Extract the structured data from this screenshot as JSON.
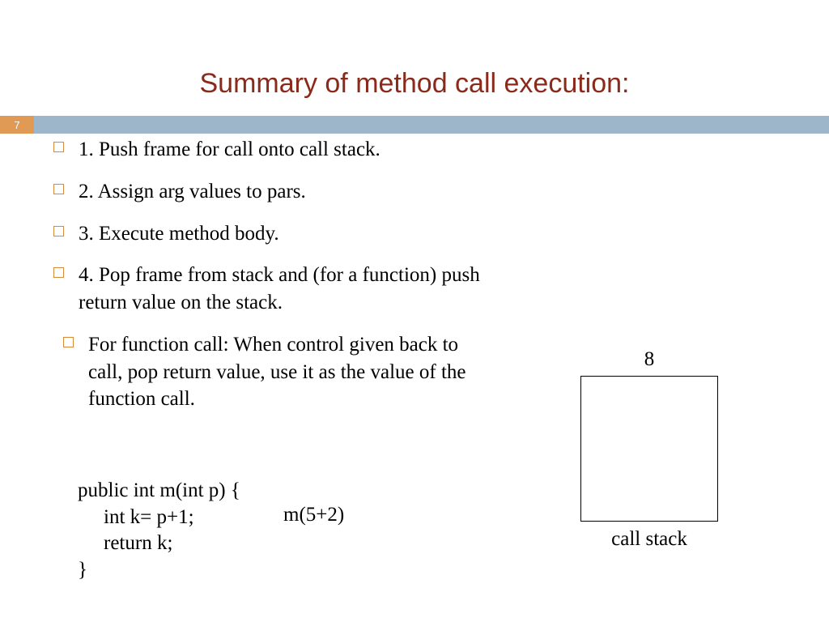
{
  "page_number": "7",
  "title": "Summary of method call execution:",
  "bullets": [
    "1. Push frame for call onto call stack.",
    "2. Assign arg values to pars.",
    "3. Execute method body.",
    "4. Pop frame from stack and (for a function) push return value on the stack.",
    "For function call: When control given back to call, pop return value, use it as the value of the function call."
  ],
  "code": {
    "l1": "public int m(int p) {",
    "l2": "int k= p+1;",
    "l3": "return k;",
    "l4": "}"
  },
  "call_expression": "m(5+2)",
  "stack": {
    "top_value": "8",
    "label": "call stack"
  }
}
